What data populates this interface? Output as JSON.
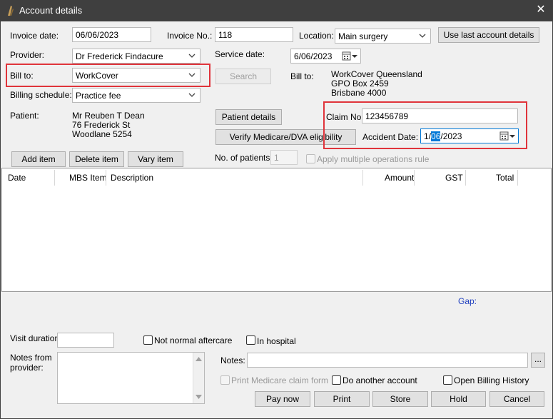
{
  "window": {
    "title": "Account details",
    "close_label": "✕"
  },
  "header": {
    "invoice_date_label": "Invoice date:",
    "invoice_date_value": "06/06/2023",
    "invoice_no_label": "Invoice No.:",
    "invoice_no_value": "118",
    "location_label": "Location:",
    "location_value": "Main surgery",
    "use_last_account_label": "Use last account details",
    "provider_label": "Provider:",
    "provider_value": "Dr Frederick Findacure",
    "service_date_label": "Service date:",
    "service_date_value": "6/06/2023",
    "bill_to_label": "Bill to:",
    "bill_to_value": "WorkCover",
    "search_label": "Search",
    "bill_to_address_label": "Bill to:",
    "bill_to_address": [
      "WorkCover Queensland",
      "GPO Box 2459",
      "Brisbane 4000"
    ],
    "billing_schedule_label": "Billing schedule:",
    "billing_schedule_value": "Practice fee",
    "patient_label": "Patient:",
    "patient_address": [
      "Mr Reuben T Dean",
      "76 Frederick St",
      "Woodlane  5254"
    ],
    "patient_details_label": "Patient details",
    "verify_label": "Verify Medicare/DVA eligibility",
    "claim_no_label": "Claim No.:",
    "claim_no_value": "123456789",
    "accident_date_label": "Accident Date:",
    "accident_date_pre": "1/",
    "accident_date_sel": "06",
    "accident_date_post": "/2023"
  },
  "items": {
    "add_item_label": "Add item",
    "delete_item_label": "Delete item",
    "vary_item_label": "Vary item",
    "no_patients_label": "No. of patients:",
    "no_patients_value": "1",
    "apply_multiple_label": "Apply multiple operations rule",
    "columns": [
      "Date",
      "MBS Item",
      "Description",
      "Amount",
      "GST",
      "Total"
    ]
  },
  "footer": {
    "gap_label": "Gap:",
    "visit_duration_label": "Visit duration:",
    "not_normal_aftercare_label": "Not normal aftercare",
    "in_hospital_label": "In hospital",
    "notes_from_provider_label": "Notes from provider:",
    "notes_label": "Notes:",
    "notes_more_label": "...",
    "print_medicare_label": "Print Medicare claim form",
    "do_another_label": "Do another account",
    "open_billing_history_label": "Open Billing History",
    "pay_now_label": "Pay now",
    "print_label": "Print",
    "store_label": "Store",
    "hold_label": "Hold",
    "cancel_label": "Cancel"
  },
  "colors": {
    "highlight": "#e0343b",
    "selection": "#0078d7",
    "gap_text": "#1f3fbf",
    "titlebar": "#3f3f3f"
  }
}
